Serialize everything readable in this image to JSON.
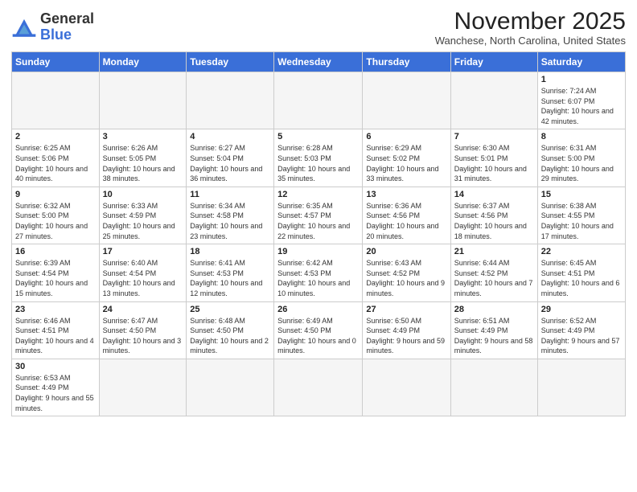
{
  "logo": {
    "text_general": "General",
    "text_blue": "Blue"
  },
  "title": "November 2025",
  "location": "Wanchese, North Carolina, United States",
  "weekdays": [
    "Sunday",
    "Monday",
    "Tuesday",
    "Wednesday",
    "Thursday",
    "Friday",
    "Saturday"
  ],
  "days": {
    "1": {
      "sunrise": "7:24 AM",
      "sunset": "6:07 PM",
      "daylight": "10 hours and 42 minutes."
    },
    "2": {
      "sunrise": "6:25 AM",
      "sunset": "5:06 PM",
      "daylight": "10 hours and 40 minutes."
    },
    "3": {
      "sunrise": "6:26 AM",
      "sunset": "5:05 PM",
      "daylight": "10 hours and 38 minutes."
    },
    "4": {
      "sunrise": "6:27 AM",
      "sunset": "5:04 PM",
      "daylight": "10 hours and 36 minutes."
    },
    "5": {
      "sunrise": "6:28 AM",
      "sunset": "5:03 PM",
      "daylight": "10 hours and 35 minutes."
    },
    "6": {
      "sunrise": "6:29 AM",
      "sunset": "5:02 PM",
      "daylight": "10 hours and 33 minutes."
    },
    "7": {
      "sunrise": "6:30 AM",
      "sunset": "5:01 PM",
      "daylight": "10 hours and 31 minutes."
    },
    "8": {
      "sunrise": "6:31 AM",
      "sunset": "5:00 PM",
      "daylight": "10 hours and 29 minutes."
    },
    "9": {
      "sunrise": "6:32 AM",
      "sunset": "5:00 PM",
      "daylight": "10 hours and 27 minutes."
    },
    "10": {
      "sunrise": "6:33 AM",
      "sunset": "4:59 PM",
      "daylight": "10 hours and 25 minutes."
    },
    "11": {
      "sunrise": "6:34 AM",
      "sunset": "4:58 PM",
      "daylight": "10 hours and 23 minutes."
    },
    "12": {
      "sunrise": "6:35 AM",
      "sunset": "4:57 PM",
      "daylight": "10 hours and 22 minutes."
    },
    "13": {
      "sunrise": "6:36 AM",
      "sunset": "4:56 PM",
      "daylight": "10 hours and 20 minutes."
    },
    "14": {
      "sunrise": "6:37 AM",
      "sunset": "4:56 PM",
      "daylight": "10 hours and 18 minutes."
    },
    "15": {
      "sunrise": "6:38 AM",
      "sunset": "4:55 PM",
      "daylight": "10 hours and 17 minutes."
    },
    "16": {
      "sunrise": "6:39 AM",
      "sunset": "4:54 PM",
      "daylight": "10 hours and 15 minutes."
    },
    "17": {
      "sunrise": "6:40 AM",
      "sunset": "4:54 PM",
      "daylight": "10 hours and 13 minutes."
    },
    "18": {
      "sunrise": "6:41 AM",
      "sunset": "4:53 PM",
      "daylight": "10 hours and 12 minutes."
    },
    "19": {
      "sunrise": "6:42 AM",
      "sunset": "4:53 PM",
      "daylight": "10 hours and 10 minutes."
    },
    "20": {
      "sunrise": "6:43 AM",
      "sunset": "4:52 PM",
      "daylight": "10 hours and 9 minutes."
    },
    "21": {
      "sunrise": "6:44 AM",
      "sunset": "4:52 PM",
      "daylight": "10 hours and 7 minutes."
    },
    "22": {
      "sunrise": "6:45 AM",
      "sunset": "4:51 PM",
      "daylight": "10 hours and 6 minutes."
    },
    "23": {
      "sunrise": "6:46 AM",
      "sunset": "4:51 PM",
      "daylight": "10 hours and 4 minutes."
    },
    "24": {
      "sunrise": "6:47 AM",
      "sunset": "4:50 PM",
      "daylight": "10 hours and 3 minutes."
    },
    "25": {
      "sunrise": "6:48 AM",
      "sunset": "4:50 PM",
      "daylight": "10 hours and 2 minutes."
    },
    "26": {
      "sunrise": "6:49 AM",
      "sunset": "4:50 PM",
      "daylight": "10 hours and 0 minutes."
    },
    "27": {
      "sunrise": "6:50 AM",
      "sunset": "4:49 PM",
      "daylight": "9 hours and 59 minutes."
    },
    "28": {
      "sunrise": "6:51 AM",
      "sunset": "4:49 PM",
      "daylight": "9 hours and 58 minutes."
    },
    "29": {
      "sunrise": "6:52 AM",
      "sunset": "4:49 PM",
      "daylight": "9 hours and 57 minutes."
    },
    "30": {
      "sunrise": "6:53 AM",
      "sunset": "4:49 PM",
      "daylight": "9 hours and 55 minutes."
    }
  }
}
